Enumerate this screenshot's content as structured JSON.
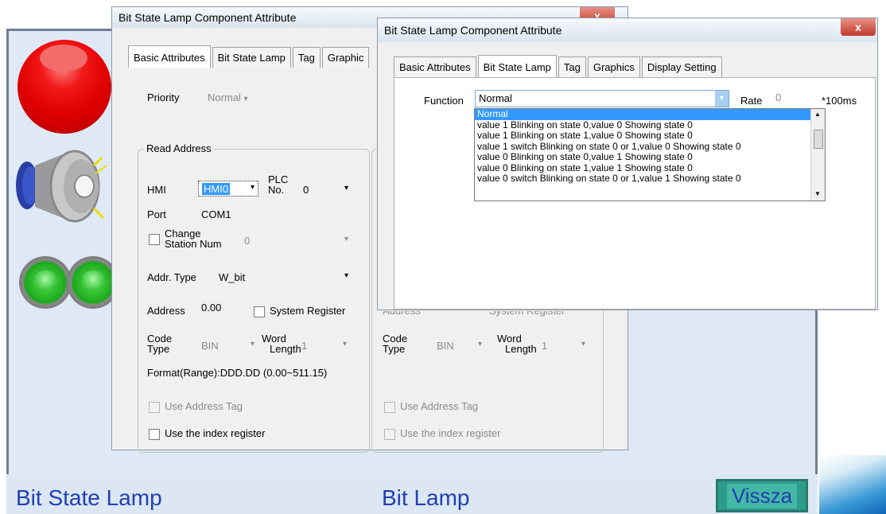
{
  "app": {
    "footer_left": "Bit State Lamp",
    "footer_center": "Bit Lamp",
    "back_button": "Vissza"
  },
  "dialog_back": {
    "title": "Bit State Lamp Component Attribute",
    "close": "x",
    "tabs": [
      "Basic Attributes",
      "Bit State Lamp",
      "Tag",
      "Graphic"
    ],
    "priority_label": "Priority",
    "priority_value": "Normal",
    "read_address_label": "Read Address",
    "hmi_label": "HMI",
    "hmi_value": "HMI0",
    "plc_label": "PLC",
    "plc_no_label": "No.",
    "plc_value": "0",
    "port_label": "Port",
    "port_value": "COM1",
    "change_station_label_1": "Change",
    "change_station_label_2": "Station Num",
    "change_station_value": "0",
    "addr_type_label": "Addr. Type",
    "addr_type_value": "W_bit",
    "address_label": "Address",
    "address_value": "0.00",
    "system_register_label": "System Register",
    "code_label": "Code",
    "type_label": "Type",
    "code_type_value": "BIN",
    "word_label": "Word",
    "length_label": "Length",
    "word_length_value": "1",
    "format_text": "Format(Range):DDD.DD (0.00~511.15)",
    "use_address_tag": "Use Address Tag",
    "use_index_register": "Use the index register",
    "right_group": {
      "address_label": "Address",
      "system_register_label": "System Register",
      "code_label": "Code",
      "type_label": "Type",
      "code_type_value": "BIN",
      "word_label": "Word",
      "length_label": "Length",
      "word_length_value": "1",
      "use_address_tag": "Use Address Tag",
      "use_index_register": "Use the index register"
    }
  },
  "dialog_front": {
    "title": "Bit State Lamp Component Attribute",
    "close": "x",
    "tabs": [
      "Basic Attributes",
      "Bit State Lamp",
      "Tag",
      "Graphics",
      "Display Setting"
    ],
    "function_label": "Function",
    "function_value": "Normal",
    "rate_label": "Rate",
    "rate_value": "0",
    "rate_unit": "*100ms",
    "options": [
      "Normal",
      "value 1 Blinking on state 0,value 0 Showing state 0",
      "value 1 Blinking on state 1,value 0 Showing state 0",
      "value 1 switch Blinking on state 0 or 1,value 0 Showing state 0",
      "value 0 Blinking on state 0,value 1 Showing state 0",
      "value 0 Blinking on state 1,value 1 Showing state 0",
      "value 0 switch Blinking on state 0 or 1,value 1 Showing state 0"
    ],
    "selected_index": 0
  },
  "colors": {
    "footer_text": "#1f40b4",
    "selection": "#3399ff",
    "back_button_bg": "#2e9c8a"
  }
}
